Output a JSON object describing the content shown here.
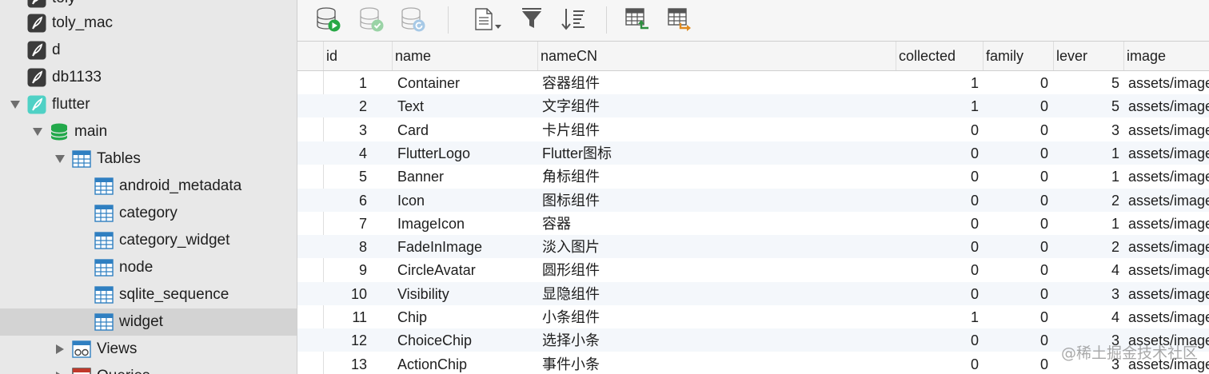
{
  "sidebar": {
    "items": [
      {
        "label": "toly",
        "icon": "sqlite-db-icon"
      },
      {
        "label": "toly_mac",
        "icon": "sqlite-db-icon"
      },
      {
        "label": "d",
        "icon": "sqlite-db-icon"
      },
      {
        "label": "db1133",
        "icon": "sqlite-db-icon"
      },
      {
        "label": "flutter",
        "icon": "sqlite-db-icon",
        "expanded": true
      },
      {
        "label": "main",
        "icon": "database-icon",
        "expanded": true
      },
      {
        "label": "Tables",
        "icon": "table-folder-icon",
        "expanded": true
      },
      {
        "label": "android_metadata",
        "icon": "table-icon"
      },
      {
        "label": "category",
        "icon": "table-icon"
      },
      {
        "label": "category_widget",
        "icon": "table-icon"
      },
      {
        "label": "node",
        "icon": "table-icon"
      },
      {
        "label": "sqlite_sequence",
        "icon": "table-icon"
      },
      {
        "label": "widget",
        "icon": "table-icon",
        "selected": true
      },
      {
        "label": "Views",
        "icon": "views-icon",
        "expanded": false
      },
      {
        "label": "Queries",
        "icon": "queries-icon",
        "expanded": false
      }
    ]
  },
  "toolbar": {
    "buttons": [
      "db-run-icon",
      "db-commit-icon",
      "db-refresh-icon",
      "document-menu-icon",
      "filter-icon",
      "sort-icon",
      "import-table-icon",
      "export-table-icon"
    ]
  },
  "grid": {
    "columns": [
      "id",
      "name",
      "nameCN",
      "collected",
      "family",
      "lever",
      "image"
    ],
    "rows": [
      [
        "1",
        "Container",
        "容器组件",
        "1",
        "0",
        "5",
        "assets/images/"
      ],
      [
        "2",
        "Text",
        "文字组件",
        "1",
        "0",
        "5",
        "assets/images/"
      ],
      [
        "3",
        "Card",
        "卡片组件",
        "0",
        "0",
        "3",
        "assets/images/"
      ],
      [
        "4",
        "FlutterLogo",
        "Flutter图标",
        "0",
        "0",
        "1",
        "assets/images/"
      ],
      [
        "5",
        "Banner",
        "角标组件",
        "0",
        "0",
        "1",
        "assets/images/"
      ],
      [
        "6",
        "Icon",
        "图标组件",
        "0",
        "0",
        "2",
        "assets/images/"
      ],
      [
        "7",
        "ImageIcon",
        "容器",
        "0",
        "0",
        "1",
        "assets/images/"
      ],
      [
        "8",
        "FadeInImage",
        "淡入图片",
        "0",
        "0",
        "2",
        "assets/images/"
      ],
      [
        "9",
        "CircleAvatar",
        "圆形组件",
        "0",
        "0",
        "4",
        "assets/images/"
      ],
      [
        "10",
        "Visibility",
        "显隐组件",
        "0",
        "0",
        "3",
        "assets/images/"
      ],
      [
        "11",
        "Chip",
        "小条组件",
        "1",
        "0",
        "4",
        "assets/images/"
      ],
      [
        "12",
        "ChoiceChip",
        "选择小条",
        "0",
        "0",
        "3",
        "assets/images/"
      ],
      [
        "13",
        "ActionChip",
        "事件小条",
        "0",
        "0",
        "3",
        "assets/images/"
      ]
    ]
  },
  "watermark": "@稀土掘金技术社区",
  "colors": {
    "accent": "#2f7fc1",
    "selected_row": "#d3d3d3",
    "alt_row": "#f4f7fb",
    "db_green": "#23a94b"
  }
}
